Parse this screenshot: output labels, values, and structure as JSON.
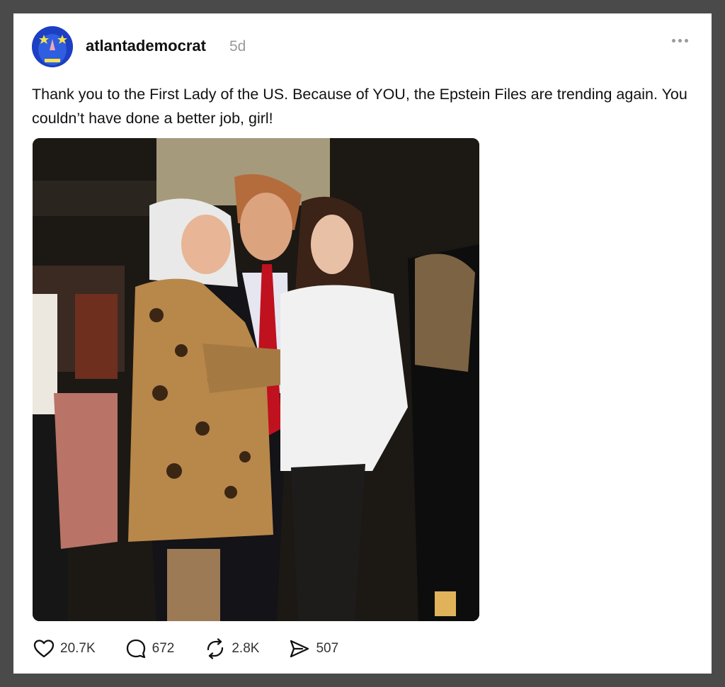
{
  "post": {
    "username": "atlantademocrat",
    "time": "5d",
    "text": "Thank you to the First Lady of the US. Because of YOU, the Epstein Files are trending again. You couldn’t have done a better job, girl!"
  },
  "stats": {
    "likes": "20.7K",
    "replies": "672",
    "reposts": "2.8K",
    "shares": "507"
  },
  "icons": {
    "avatar": "blue-face-avatar",
    "more": "more-options-icon",
    "like": "heart-icon",
    "reply": "comment-icon",
    "repost": "repost-icon",
    "share": "send-icon"
  },
  "colors": {
    "frame": "#4a4a4a",
    "card": "#ffffff",
    "text": "#111111",
    "muted": "#9a9a9a"
  }
}
